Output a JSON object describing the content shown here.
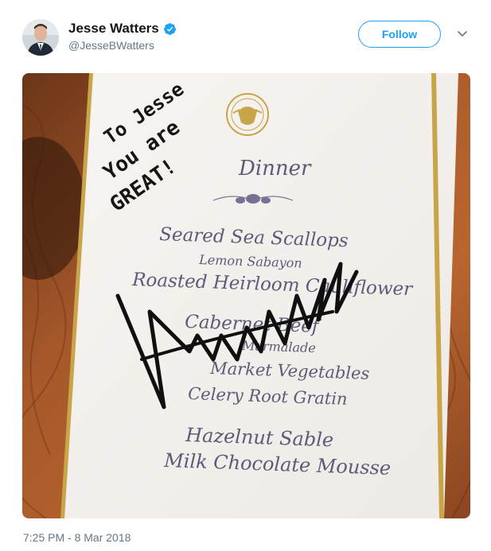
{
  "author": {
    "display_name": "Jesse Watters",
    "handle": "@JesseBWatters",
    "verified": true,
    "verified_icon": "verified-badge-icon",
    "verified_color": "#1da1f2"
  },
  "actions": {
    "follow_label": "Follow",
    "more_icon": "chevron-down-icon"
  },
  "photo": {
    "handwritten_note": [
      "To Jesse",
      "You are",
      "GREAT!"
    ],
    "menu_heading": "Dinner",
    "menu_items": [
      "Seared Sea Scallops",
      "Lemon Sabayon",
      "Roasted Heirloom Cauliflower",
      "Cabernet Beef",
      "Marmalade",
      "Market Vegetables",
      "Celery Root Gratin",
      "Hazelnut Sable",
      "Milk Chocolate Mousse"
    ]
  },
  "meta": {
    "timestamp": "7:25 PM - 8 Mar 2018"
  },
  "colors": {
    "accent": "#1da1f2",
    "name": "#14171a",
    "secondary": "#657786",
    "wood": "#a0552a",
    "card": "#f6f3ef",
    "ink": "#5f5a78",
    "gold": "#c9a54a"
  }
}
